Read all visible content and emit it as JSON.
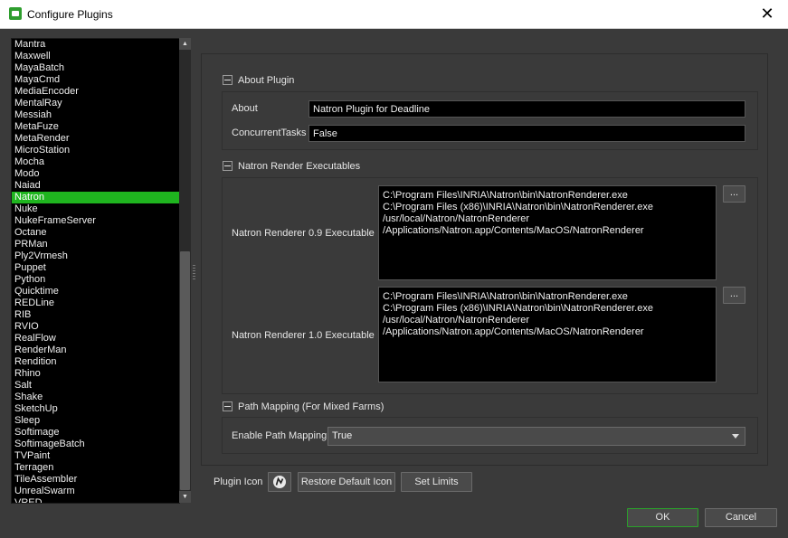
{
  "window": {
    "title": "Configure Plugins",
    "close_glyph": "✕"
  },
  "plugins": {
    "selected": "Natron",
    "items": [
      "Mantra",
      "Maxwell",
      "MayaBatch",
      "MayaCmd",
      "MediaEncoder",
      "MentalRay",
      "Messiah",
      "MetaFuze",
      "MetaRender",
      "MicroStation",
      "Mocha",
      "Modo",
      "Naiad",
      "Natron",
      "Nuke",
      "NukeFrameServer",
      "Octane",
      "PRMan",
      "Ply2Vrmesh",
      "Puppet",
      "Python",
      "Quicktime",
      "REDLine",
      "RIB",
      "RVIO",
      "RealFlow",
      "RenderMan",
      "Rendition",
      "Rhino",
      "Salt",
      "Shake",
      "SketchUp",
      "Sleep",
      "Softimage",
      "SoftimageBatch",
      "TVPaint",
      "Terragen",
      "TileAssembler",
      "UnrealSwarm",
      "VRED"
    ]
  },
  "about_plugin": {
    "header": "About Plugin",
    "about_label": "About",
    "about_value": "Natron Plugin for Deadline",
    "concurrent_label": "ConcurrentTasks",
    "concurrent_value": "False"
  },
  "executables": {
    "header": "Natron Render Executables",
    "v09_label": "Natron Renderer 0.9 Executable",
    "v09_paths": "C:\\Program Files\\INRIA\\Natron\\bin\\NatronRenderer.exe\nC:\\Program Files (x86)\\INRIA\\Natron\\bin\\NatronRenderer.exe\n/usr/local/Natron/NatronRenderer\n/Applications/Natron.app/Contents/MacOS/NatronRenderer",
    "v10_label": "Natron Renderer 1.0 Executable",
    "v10_paths": "C:\\Program Files\\INRIA\\Natron\\bin\\NatronRenderer.exe\nC:\\Program Files (x86)\\INRIA\\Natron\\bin\\NatronRenderer.exe\n/usr/local/Natron/NatronRenderer\n/Applications/Natron.app/Contents/MacOS/NatronRenderer",
    "browse_label": "..."
  },
  "path_mapping": {
    "header": "Path Mapping (For Mixed Farms)",
    "enable_label": "Enable Path Mapping",
    "enable_value": "True"
  },
  "footer": {
    "plugin_icon_label": "Plugin Icon",
    "restore_label": "Restore Default Icon",
    "set_limits_label": "Set Limits",
    "ok_label": "OK",
    "cancel_label": "Cancel"
  },
  "colors": {
    "selection": "#1fb51f",
    "background": "#3a3a3a",
    "field": "#000000"
  }
}
